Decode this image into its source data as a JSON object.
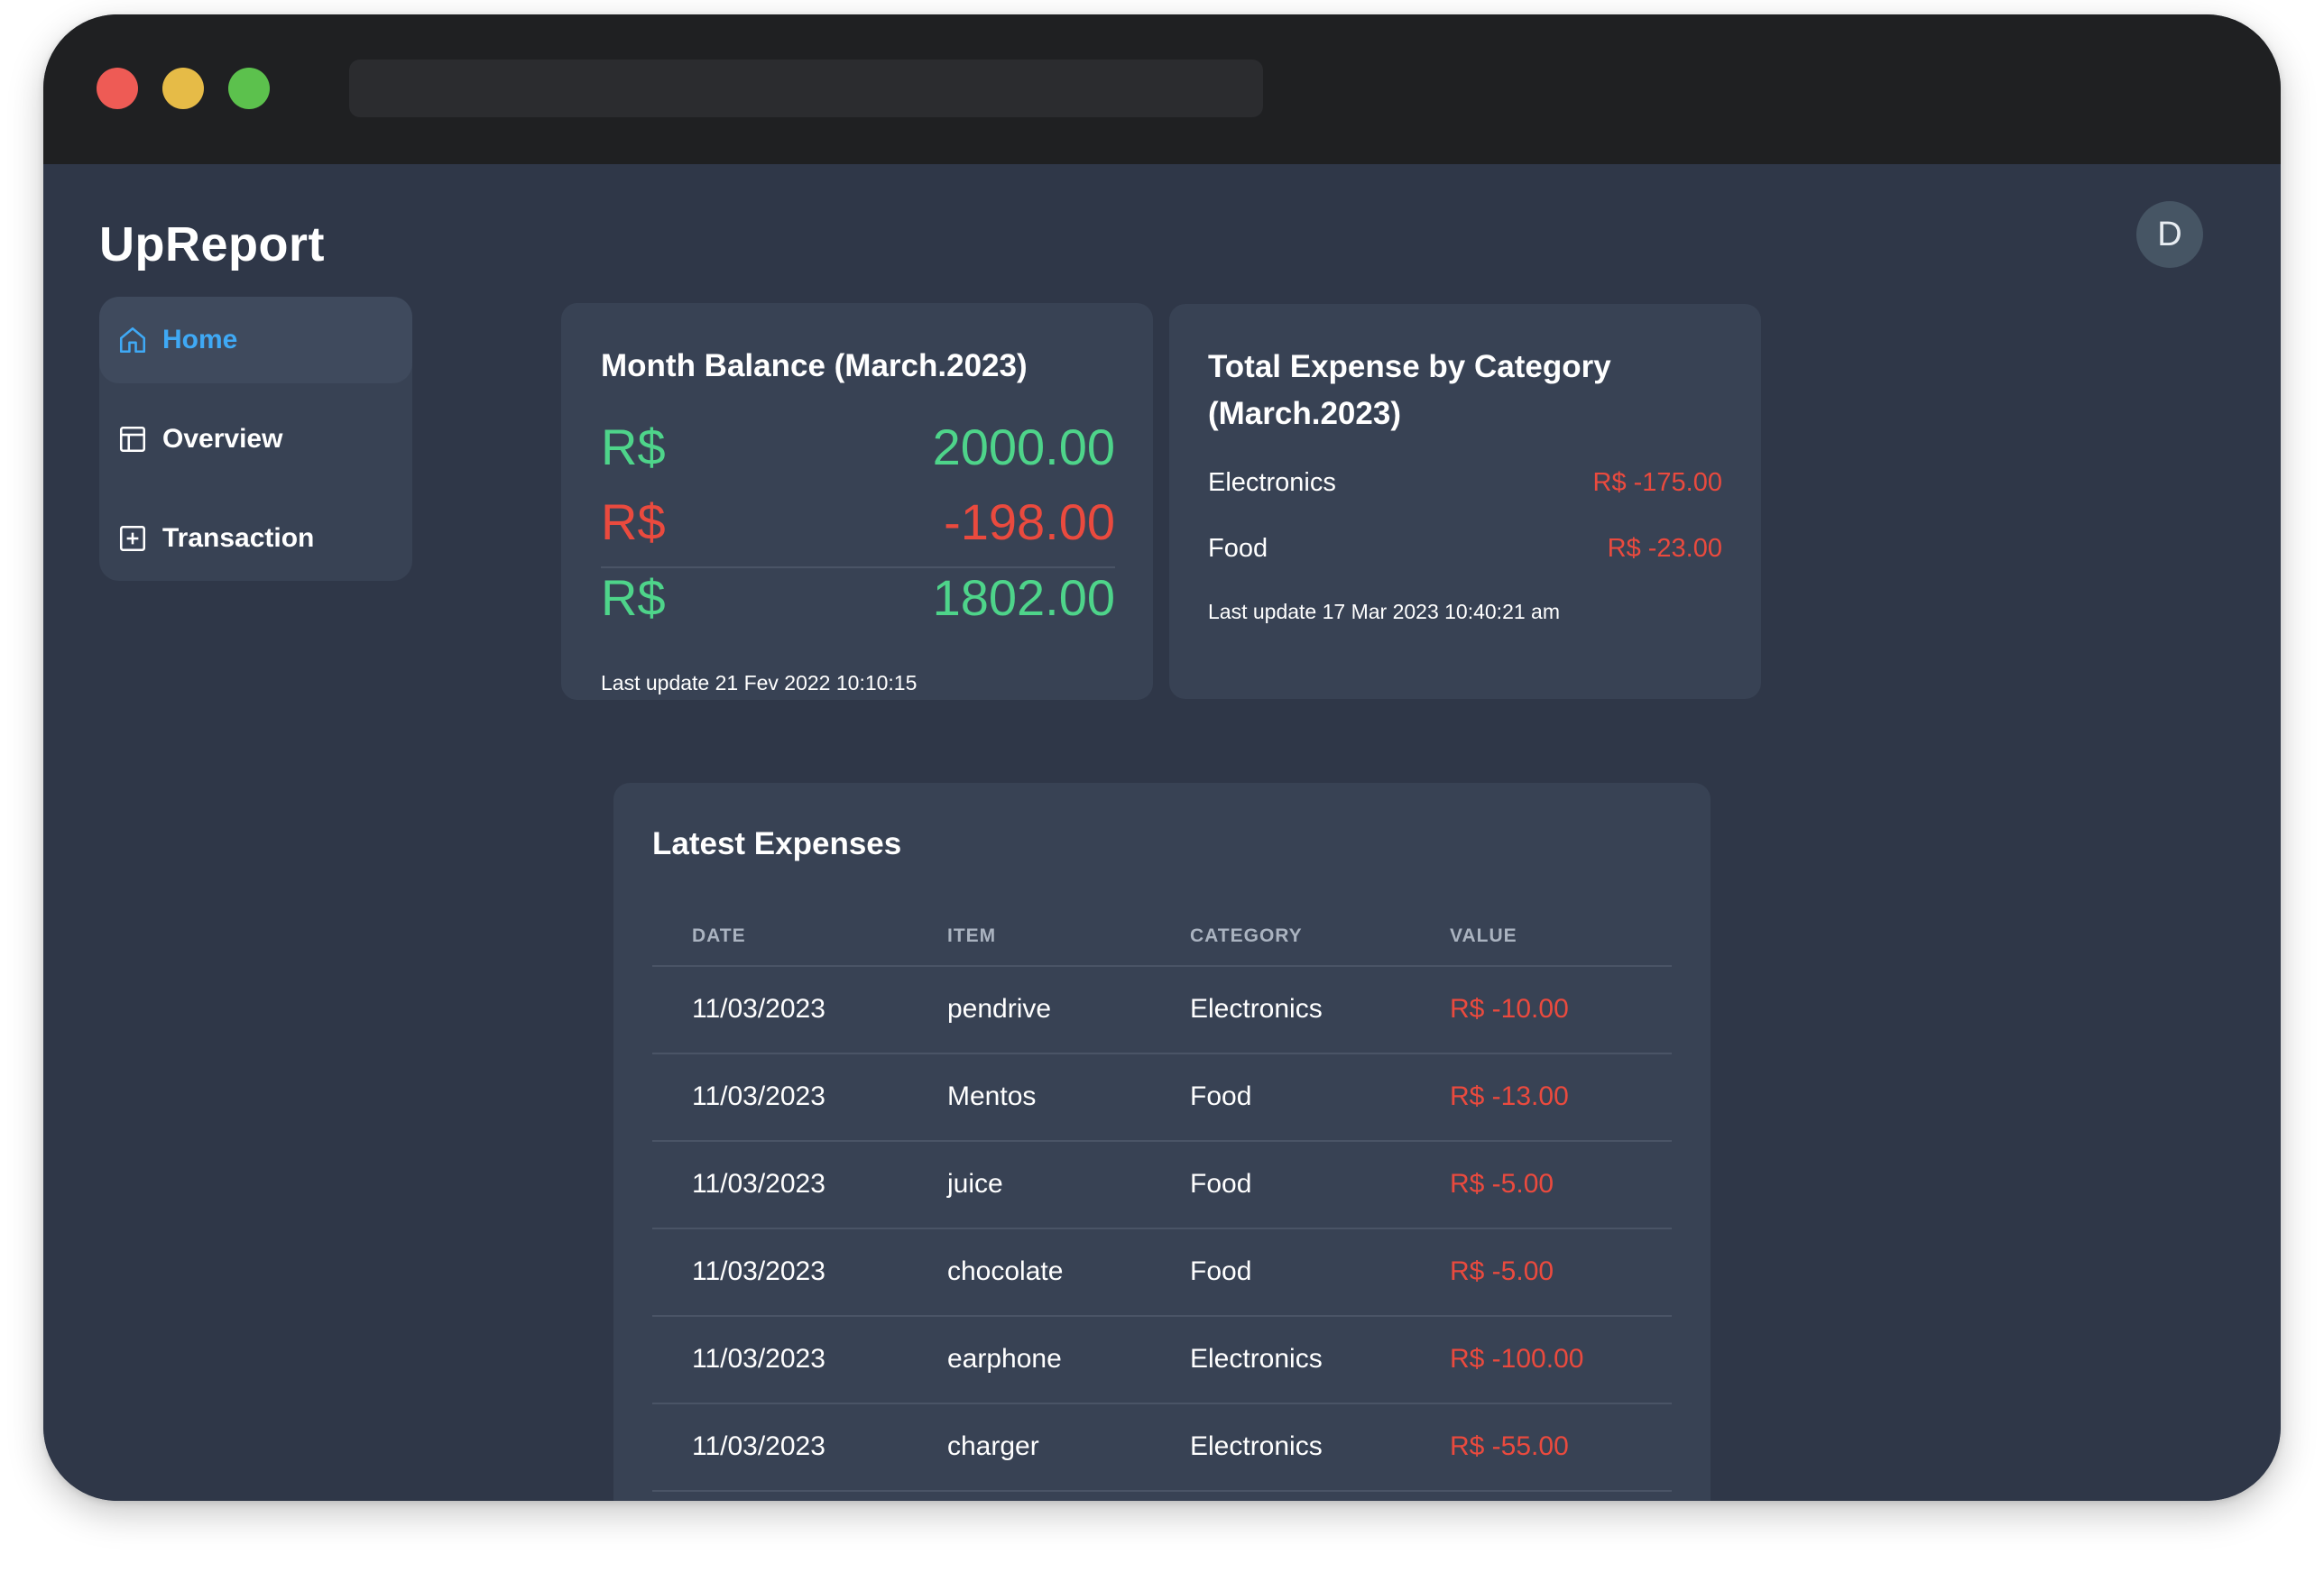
{
  "app": {
    "name": "UpReport",
    "user_initial": "D"
  },
  "sidebar": {
    "items": [
      {
        "label": "Home",
        "icon": "home-icon",
        "active": true
      },
      {
        "label": "Overview",
        "icon": "layout-icon",
        "active": false
      },
      {
        "label": "Transaction",
        "icon": "plus-square-icon",
        "active": false
      }
    ]
  },
  "balance_card": {
    "title": "Month Balance (March.2023)",
    "income": {
      "currency": "R$",
      "value": "2000.00"
    },
    "expense": {
      "currency": "R$",
      "value": "-198.00"
    },
    "total": {
      "currency": "R$",
      "value": "1802.00"
    },
    "last_update": "Last update 21 Fev 2022 10:10:15"
  },
  "category_card": {
    "title": "Total Expense by Category (March.2023)",
    "rows": [
      {
        "name": "Electronics",
        "value": "R$ -175.00"
      },
      {
        "name": "Food",
        "value": "R$ -23.00"
      }
    ],
    "last_update": "Last update 17 Mar 2023 10:40:21 am"
  },
  "expenses": {
    "title": "Latest Expenses",
    "columns": [
      "DATE",
      "ITEM",
      "CATEGORY",
      "VALUE"
    ],
    "rows": [
      {
        "date": "11/03/2023",
        "item": "pendrive",
        "category": "Electronics",
        "value": "R$ -10.00"
      },
      {
        "date": "11/03/2023",
        "item": "Mentos",
        "category": "Food",
        "value": "R$ -13.00"
      },
      {
        "date": "11/03/2023",
        "item": "juice",
        "category": "Food",
        "value": "R$ -5.00"
      },
      {
        "date": "11/03/2023",
        "item": "chocolate",
        "category": "Food",
        "value": "R$ -5.00"
      },
      {
        "date": "11/03/2023",
        "item": "earphone",
        "category": "Electronics",
        "value": "R$ -100.00"
      },
      {
        "date": "11/03/2023",
        "item": "charger",
        "category": "Electronics",
        "value": "R$ -55.00"
      }
    ]
  },
  "colors": {
    "positive": "#4ed48a",
    "negative": "#ea4a3e",
    "accent": "#3fa9f5",
    "background": "#2f3748",
    "card": "#384254"
  }
}
